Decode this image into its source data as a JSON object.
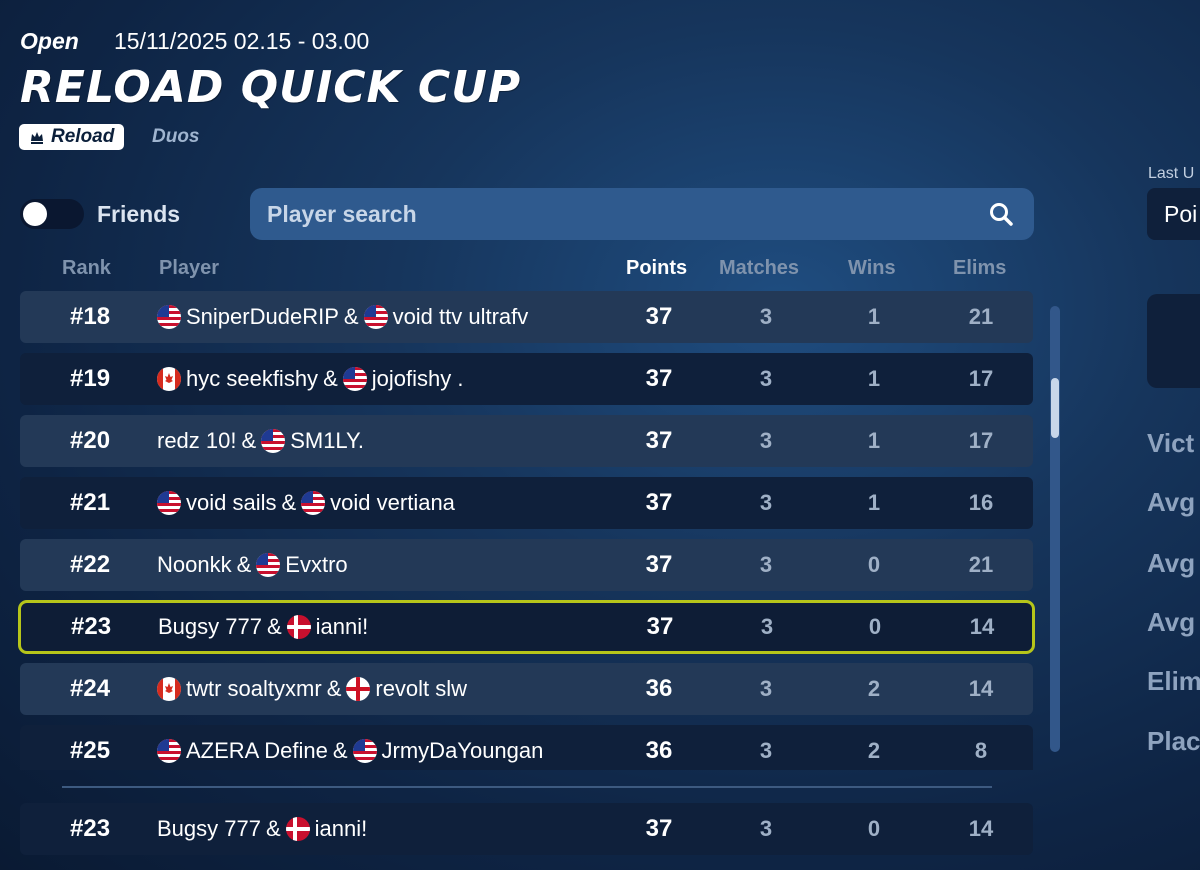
{
  "header": {
    "status": "Open",
    "datetime": "15/11/2025 02.15 - 03.00",
    "title": "RELOAD QUICK CUP",
    "badge_label": "Reload",
    "mode": "Duos"
  },
  "filters": {
    "friends_label": "Friends",
    "friends_toggle_on": false,
    "search_placeholder": "Player search"
  },
  "table": {
    "columns": {
      "rank": "Rank",
      "player": "Player",
      "points": "Points",
      "matches": "Matches",
      "wins": "Wins",
      "elims": "Elims"
    },
    "rows": [
      {
        "rank": "#18",
        "p1": "SniperDudeRIP",
        "p1_flag": "us",
        "sep": "&",
        "p2": "void ttv ultrafv",
        "p2_flag": "us",
        "points": "37",
        "matches": "3",
        "wins": "1",
        "elims": "21"
      },
      {
        "rank": "#19",
        "p1": "hyc seekfishy",
        "p1_flag": "ca",
        "sep": "&",
        "p2": "jojofishy .",
        "p2_flag": "us",
        "points": "37",
        "matches": "3",
        "wins": "1",
        "elims": "17"
      },
      {
        "rank": "#20",
        "p1": "redz 10!",
        "p1_flag": "",
        "sep": "&",
        "p2": "SM1LY.",
        "p2_flag": "us",
        "points": "37",
        "matches": "3",
        "wins": "1",
        "elims": "17"
      },
      {
        "rank": "#21",
        "p1": "void sails",
        "p1_flag": "us",
        "sep": "&",
        "p2": "void vertiana",
        "p2_flag": "us",
        "points": "37",
        "matches": "3",
        "wins": "1",
        "elims": "16"
      },
      {
        "rank": "#22",
        "p1": "Noonkk",
        "p1_flag": "",
        "sep": "&",
        "p2": "Evxtro",
        "p2_flag": "us",
        "points": "37",
        "matches": "3",
        "wins": "0",
        "elims": "21"
      },
      {
        "rank": "#23",
        "p1": "Bugsy 777",
        "p1_flag": "",
        "sep": "&",
        "p2": "ianni!",
        "p2_flag": "dk",
        "points": "37",
        "matches": "3",
        "wins": "0",
        "elims": "14"
      },
      {
        "rank": "#24",
        "p1": "twtr soaltyxmr",
        "p1_flag": "ca",
        "sep": "&",
        "p2": "revolt slw",
        "p2_flag": "en",
        "points": "36",
        "matches": "3",
        "wins": "2",
        "elims": "14"
      },
      {
        "rank": "#25",
        "p1": "AZERA Define",
        "p1_flag": "us",
        "sep": "&",
        "p2": "JrmyDaYoungan",
        "p2_flag": "us",
        "points": "36",
        "matches": "3",
        "wins": "2",
        "elims": "8"
      }
    ],
    "pinned_row": {
      "rank": "#23",
      "p1": "Bugsy 777",
      "p1_flag": "",
      "sep": "&",
      "p2": "ianni!",
      "p2_flag": "dk",
      "points": "37",
      "matches": "3",
      "wins": "0",
      "elims": "14"
    }
  },
  "right_panel": {
    "last_label": "Last U",
    "dropdown_value": "Poi",
    "stats": [
      "Vict",
      "Avg",
      "Avg",
      "Avg",
      "Elim",
      "Plac"
    ]
  },
  "colors": {
    "highlight_border": "#b6c51a",
    "search_bg": "#2f5a8e"
  }
}
